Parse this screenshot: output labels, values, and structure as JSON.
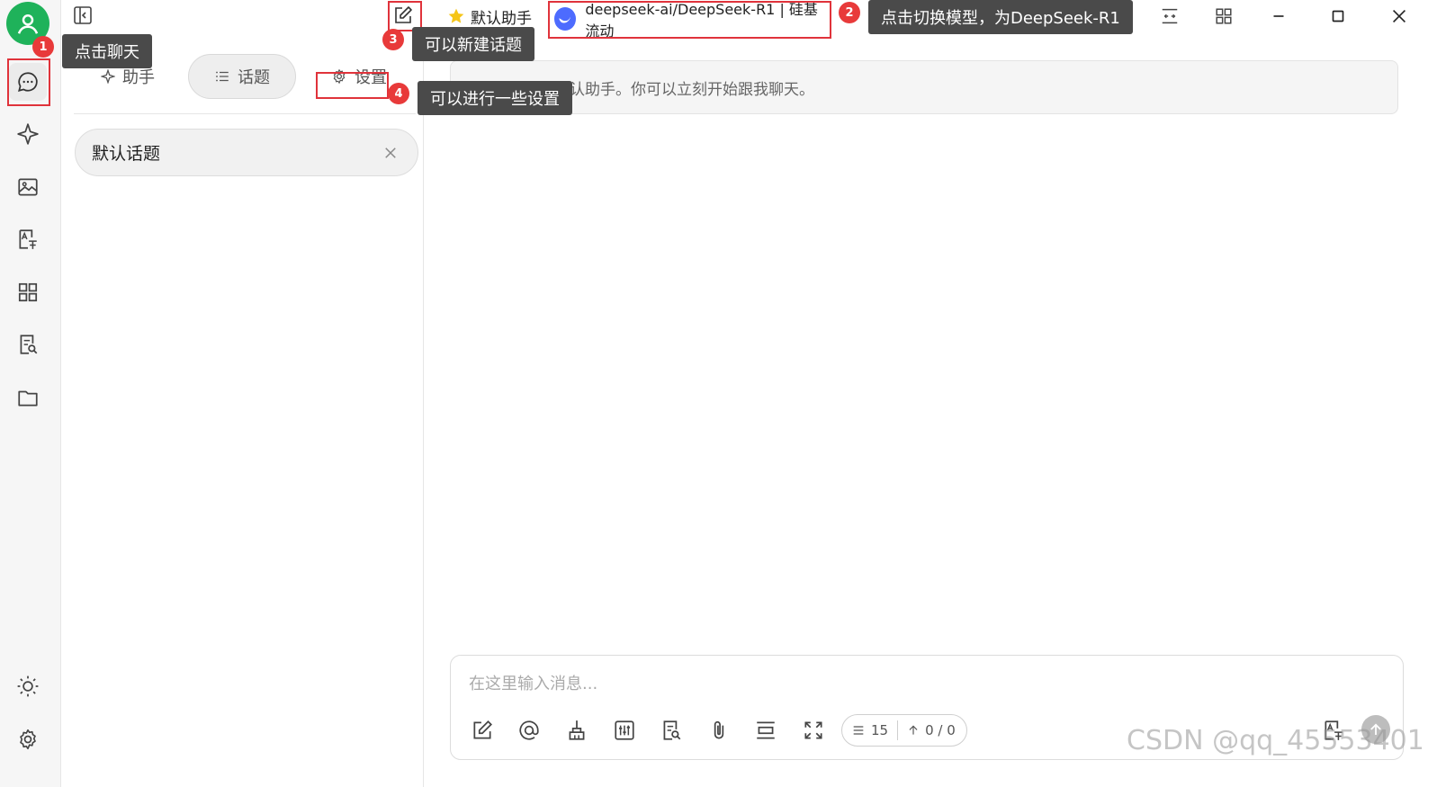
{
  "titlebar": {
    "assistant_name": "默认助手",
    "model_label": "deepseek-ai/DeepSeek-R1 | 硅基流动"
  },
  "side_panel": {
    "tabs": [
      {
        "label": "助手",
        "icon": "sparkle-icon"
      },
      {
        "label": "话题",
        "icon": "list-icon"
      },
      {
        "label": "设置",
        "icon": "gear-icon"
      }
    ],
    "active_tab": "话题",
    "topics": [
      {
        "title": "默认话题"
      }
    ]
  },
  "chat": {
    "welcome_message": "你好，我是默认助手。你可以立刻开始跟我聊天。"
  },
  "input": {
    "placeholder": "在这里输入消息...",
    "context_count": "15",
    "token_count": "0 / 0"
  },
  "annotations": {
    "badges": [
      "1",
      "2",
      "3",
      "4"
    ],
    "tips": {
      "chat": "点击聊天",
      "switch_model": "点击切换模型，为DeepSeek-R1",
      "new_topic": "可以新建话题",
      "settings": "可以进行一些设置"
    },
    "accent_red": "#e0333b"
  },
  "watermark": "CSDN @qq_45553401",
  "colors": {
    "avatar": "#1fb25a",
    "model_logo": "#4d6bfe",
    "star": "#f5c518"
  }
}
